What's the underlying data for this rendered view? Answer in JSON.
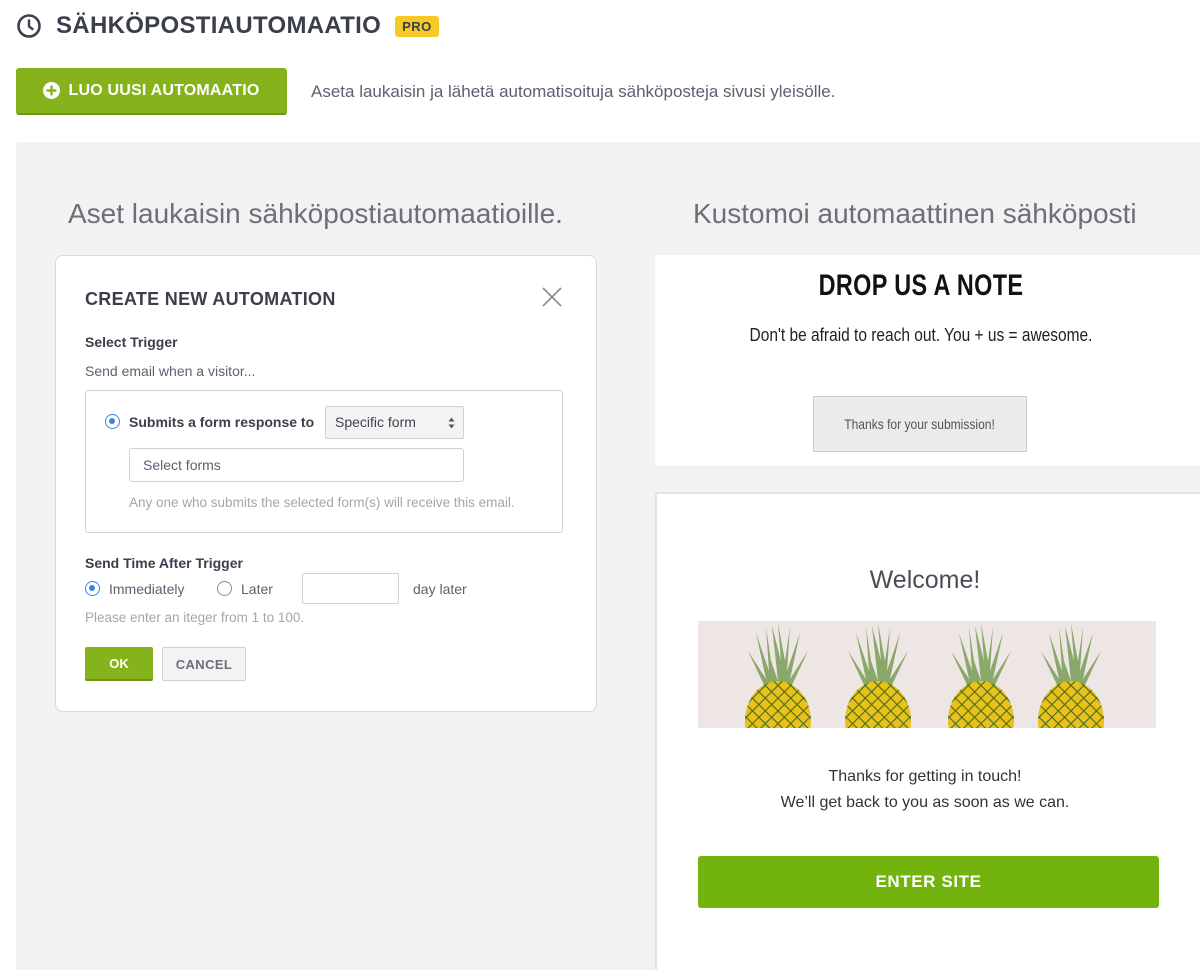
{
  "header": {
    "title": "SÄHKÖPOSTIAUTOMAATIO",
    "badge": "PRO",
    "icon": "clock-icon"
  },
  "actions": {
    "create_label": "LUO UUSI AUTOMAATIO",
    "description": "Aseta laukaisin ja lähetä automatisoituja sähköposteja sivusi yleisölle."
  },
  "headings": {
    "left": "Aset laukaisin sähköpostiautomaatioille.",
    "right": "Kustomoi automaattinen sähköposti"
  },
  "dialog": {
    "title": "CREATE NEW AUTOMATION",
    "select_trigger_label": "Select Trigger",
    "trigger_intro": "Send email when a visitor...",
    "trigger_option": "Submits a form response to",
    "form_scope_select": "Specific form",
    "forms_input_placeholder": "Select forms",
    "trigger_hint": "Any one who submits the selected form(s) will receive this email.",
    "send_time_label": "Send Time After Trigger",
    "immediately_label": "Immediately",
    "later_label": "Later",
    "later_days_value": "",
    "day_later_suffix": "day later",
    "integer_hint": "Please enter an iteger  from 1 to 100.",
    "ok_label": "OK",
    "cancel_label": "CANCEL",
    "selected_send_time": "Immediately"
  },
  "note_preview": {
    "title": "DROP US A NOTE",
    "subtitle": "Don't be afraid to reach out. You + us = awesome.",
    "button": "Thanks for your submission!"
  },
  "welcome_preview": {
    "title": "Welcome!",
    "line1": "Thanks for getting in touch!",
    "line2": "We’ll get back to you as soon as we can.",
    "button": "ENTER SITE"
  },
  "colors": {
    "accent_green": "#86b21c",
    "badge_yellow": "#f6c926",
    "radio_blue": "#3b82e6",
    "panel_bg": "#f2f2f3"
  }
}
